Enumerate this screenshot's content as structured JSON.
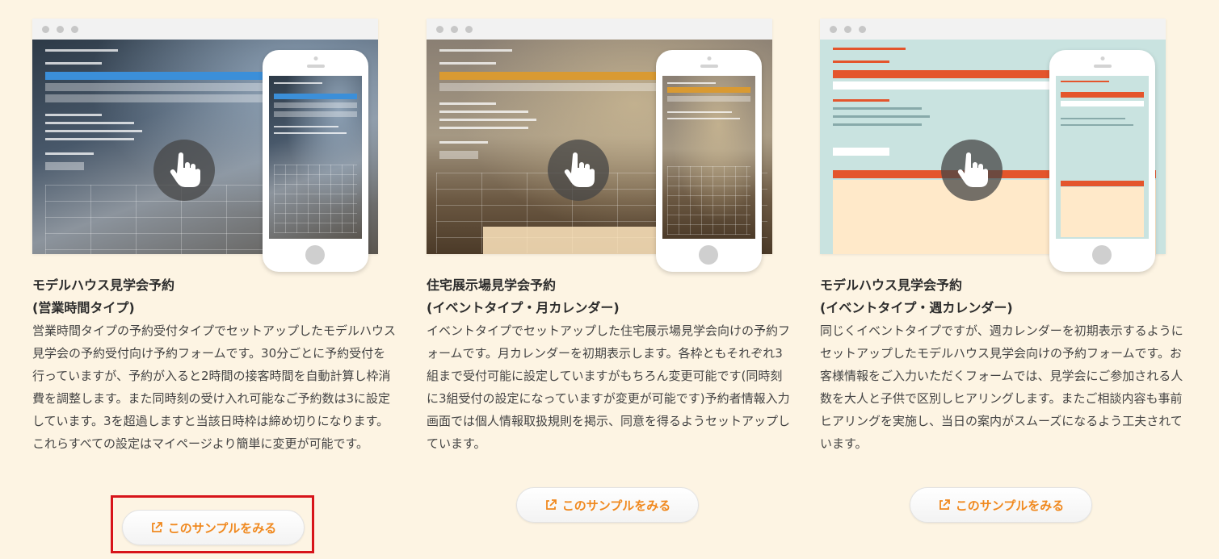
{
  "cards": [
    {
      "title_line1": "モデルハウス見学会予約",
      "title_line2": "(営業時間タイプ)",
      "description": "営業時間タイプの予約受付タイプでセットアップしたモデルハウス見学会の予約受付向け予約フォームです。30分ごとに予約受付を行っていますが、予約が入ると2時間の接客時間を自動計算し枠消費を調整します。また同時刻の受け入れ可能なご予約数は3に設定しています。3を超過しますと当該日時枠は締め切りになります。これらすべての設定はマイページより簡単に変更が可能です。",
      "button_label": "このサンプルをみる"
    },
    {
      "title_line1": "住宅展示場見学会予約",
      "title_line2": "(イベントタイプ・月カレンダー)",
      "description": "イベントタイプでセットアップした住宅展示場見学会向けの予約フォームです。月カレンダーを初期表示します。各枠ともそれぞれ3組まで受付可能に設定していますがもちろん変更可能です(同時刻に3組受付の設定になっていますが変更が可能です)予約者情報入力画面では個人情報取扱規則を掲示、同意を得るようセットアップしています。",
      "button_label": "このサンプルをみる"
    },
    {
      "title_line1": "モデルハウス見学会予約",
      "title_line2": "(イベントタイプ・週カレンダー)",
      "description": "同じくイベントタイプですが、週カレンダーを初期表示するようにセットアップしたモデルハウス見学会向けの予約フォームです。お客様情報をご入力いただくフォームでは、見学会にご参加される人数を大人と子供で区別しヒアリングします。またご相談内容も事前ヒアリングを実施し、当日の案内がスムーズになるよう工夫されています。",
      "button_label": "このサンプルをみる"
    }
  ],
  "colors": {
    "background": "#fdf4e3",
    "button_text": "#f0891f",
    "highlight_border": "#d7141a",
    "card2_accent": "#d99a32",
    "card3_accent": "#e4552c"
  },
  "icons": [
    "browser-dots",
    "hand-pointer-icon",
    "external-link-icon",
    "smartphone"
  ]
}
